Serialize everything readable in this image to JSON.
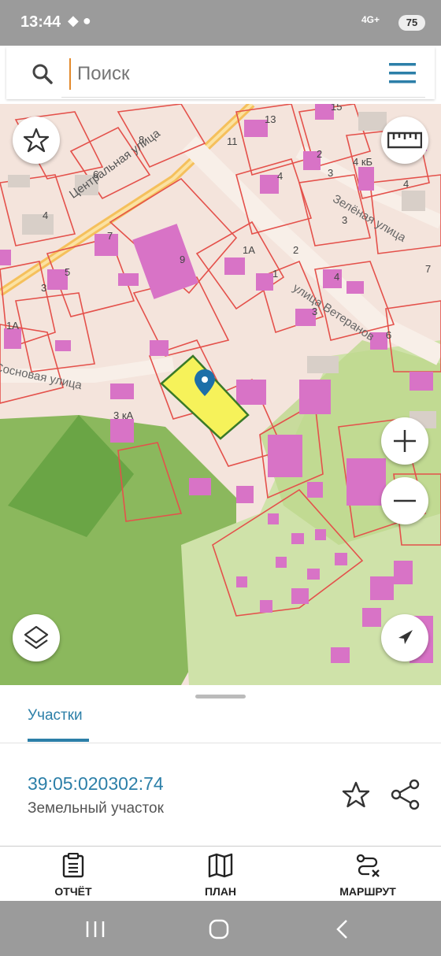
{
  "status_bar": {
    "time": "13:44",
    "network": "4G+",
    "battery": "75"
  },
  "search": {
    "placeholder": "Поиск"
  },
  "map": {
    "street_labels": [
      "Центральная улица",
      "Зелёная улица",
      "улица Ветеранов",
      "Сосновая улица"
    ],
    "house_numbers": [
      "15",
      "13",
      "11",
      "8",
      "6",
      "4",
      "7",
      "9",
      "5",
      "3",
      "1А",
      "1А",
      "2",
      "1",
      "3 кА",
      "2",
      "4",
      "3",
      "4 кБ",
      "4",
      "3",
      "4",
      "3",
      "7",
      "6"
    ]
  },
  "sheet": {
    "tab_label": "Участки",
    "parcel_number": "39:05:020302:74",
    "parcel_type": "Земельный участок"
  },
  "bottom_nav": {
    "report_label": "ОТЧЁТ",
    "plan_label": "ПЛАН",
    "route_label": "МАРШРУТ"
  },
  "colors": {
    "accent": "#2c7fa8",
    "parcel_highlight": "#f6f25a",
    "building": "#d873c6",
    "boundary": "#e4514b",
    "green_zone": "#a9d07a"
  }
}
